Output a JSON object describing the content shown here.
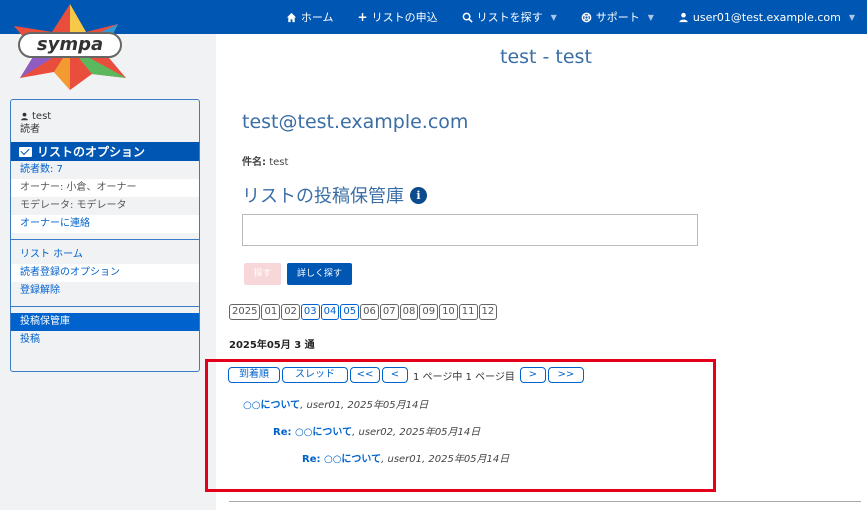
{
  "nav": {
    "home": "ホーム",
    "request": "リストの申込",
    "find": "リストを探す",
    "support": "サポート",
    "user": "user01@test.example.com"
  },
  "logo": {
    "text": "sympa"
  },
  "sidebar": {
    "user_name": "test",
    "user_role": "読者",
    "options_title": "リストのオプション",
    "subscribers": "読者数: 7",
    "owners": "オーナー: 小倉、オーナー",
    "moderators": "モデレータ: モデレータ",
    "contact_owners": "オーナーに連絡",
    "list_home": "リスト ホーム",
    "sub_options": "読者登録のオプション",
    "unsubscribe": "登録解除",
    "archives": "投稿保管庫",
    "post": "投稿"
  },
  "main": {
    "page_title": "test - test",
    "list_email": "test@test.example.com",
    "subject_label": "件名:",
    "subject_value": "test",
    "archive_title": "リストの投稿保管庫",
    "search_placeholder": "",
    "search_button": "探す",
    "advanced_button": "詳しく探す",
    "year": "2025",
    "months": [
      "01",
      "02",
      "03",
      "04",
      "05",
      "06",
      "07",
      "08",
      "09",
      "10",
      "11",
      "12"
    ],
    "active_months": [
      "03",
      "04",
      "05"
    ],
    "period": "2025年05月 3 通",
    "pager": {
      "by_date": "到着順",
      "by_thread": "スレッド",
      "first": "<<",
      "prev": "<",
      "info": "1 ページ中 1 ページ目",
      "next": ">",
      "last": ">>"
    },
    "messages": [
      {
        "re": "",
        "subject": "○○について",
        "meta": ", user01, 2025年05月14日"
      },
      {
        "re": "Re: ",
        "subject": "○○について",
        "meta": ", user02, 2025年05月14日"
      },
      {
        "re": "Re: ",
        "subject": "○○について",
        "meta": ", user01, 2025年05月14日"
      }
    ]
  },
  "colors": {
    "nav": "#0056b3",
    "accent": "#0062cc",
    "highlight": "#e4001b"
  }
}
